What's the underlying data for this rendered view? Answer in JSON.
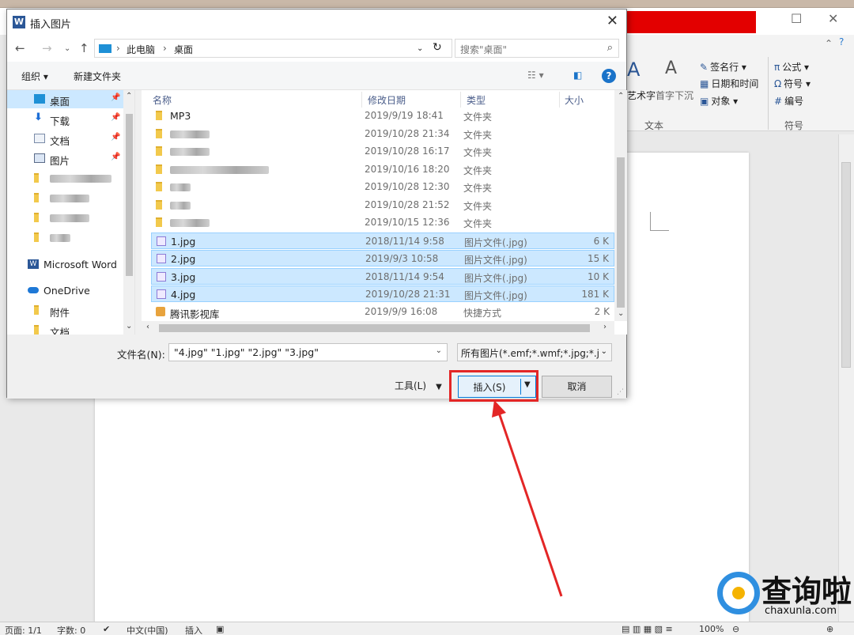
{
  "dialog": {
    "title": "插入图片",
    "breadcrumb": [
      "此电脑",
      "桌面"
    ],
    "search_placeholder": "搜索\"桌面\"",
    "organize": "组织 ▾",
    "new_folder": "新建文件夹",
    "columns": {
      "name": "名称",
      "date": "修改日期",
      "type": "类型",
      "size": "大小"
    }
  },
  "sidebar": {
    "items": [
      {
        "label": "桌面",
        "pinned": true,
        "selected": true
      },
      {
        "label": "下载",
        "pinned": true
      },
      {
        "label": "文档",
        "pinned": true
      },
      {
        "label": "图片",
        "pinned": true
      },
      {
        "label": "",
        "blurred": true
      },
      {
        "label": "",
        "blurred": true
      },
      {
        "label": "",
        "blurred": true
      },
      {
        "label": "",
        "blurred": true
      },
      {
        "label": "Microsoft Word"
      },
      {
        "label": "OneDrive"
      },
      {
        "label": "附件"
      },
      {
        "label": "文档"
      }
    ]
  },
  "files": [
    {
      "name": "MP3",
      "date": "2019/9/19 18:41",
      "type": "文件夹",
      "size": "",
      "kind": "folder"
    },
    {
      "name": "",
      "date": "2019/10/28 21:34",
      "type": "文件夹",
      "size": "",
      "kind": "folder",
      "blurred": true
    },
    {
      "name": "",
      "date": "2019/10/28 16:17",
      "type": "文件夹",
      "size": "",
      "kind": "folder",
      "blurred": true
    },
    {
      "name": "",
      "date": "2019/10/16 18:20",
      "type": "文件夹",
      "size": "",
      "kind": "folder",
      "blurred": true
    },
    {
      "name": "",
      "date": "2019/10/28 12:30",
      "type": "文件夹",
      "size": "",
      "kind": "folder",
      "blurred": true
    },
    {
      "name": "",
      "date": "2019/10/28 21:52",
      "type": "文件夹",
      "size": "",
      "kind": "folder",
      "blurred": true
    },
    {
      "name": "",
      "date": "2019/10/15 12:36",
      "type": "文件夹",
      "size": "",
      "kind": "folder",
      "blurred": true
    },
    {
      "name": "1.jpg",
      "date": "2018/11/14 9:58",
      "type": "图片文件(.jpg)",
      "size": "6 K",
      "kind": "image",
      "selected": true
    },
    {
      "name": "2.jpg",
      "date": "2019/9/3 10:58",
      "type": "图片文件(.jpg)",
      "size": "15 K",
      "kind": "image",
      "selected": true
    },
    {
      "name": "3.jpg",
      "date": "2018/11/14 9:54",
      "type": "图片文件(.jpg)",
      "size": "10 K",
      "kind": "image",
      "selected": true
    },
    {
      "name": "4.jpg",
      "date": "2019/10/28 21:31",
      "type": "图片文件(.jpg)",
      "size": "181 K",
      "kind": "image",
      "selected": true
    },
    {
      "name": "腾讯影视库",
      "date": "2019/9/9 16:08",
      "type": "快捷方式",
      "size": "2 K",
      "kind": "shortcut"
    }
  ],
  "footer": {
    "filename_label": "文件名(N):",
    "filename_value": "\"4.jpg\" \"1.jpg\" \"2.jpg\" \"3.jpg\"",
    "filter_value": "所有图片(*.emf;*.wmf;*.jpg;*.j",
    "tools": "工具(L)",
    "insert": "插入(S)",
    "cancel": "取消"
  },
  "ribbon": {
    "art_word": "艺术字",
    "drop_cap": "首字下沉",
    "signature": "签名行 ▾",
    "datetime": "日期和时间",
    "object": "对象 ▾",
    "equation": "公式 ▾",
    "symbol": "符号 ▾",
    "numbering": "编号",
    "group_text": "文本",
    "group_symbols": "符号"
  },
  "status": {
    "page": "页面: 1/1",
    "words": "字数: 0",
    "lang": "中文(中国)",
    "mode": "插入",
    "zoom": "100%"
  },
  "watermark": {
    "text": "查询啦",
    "sub": "chaxunla.com"
  },
  "colors": {
    "highlight": "#e32626",
    "selection": "#cce8ff",
    "word_red": "#e30000"
  }
}
